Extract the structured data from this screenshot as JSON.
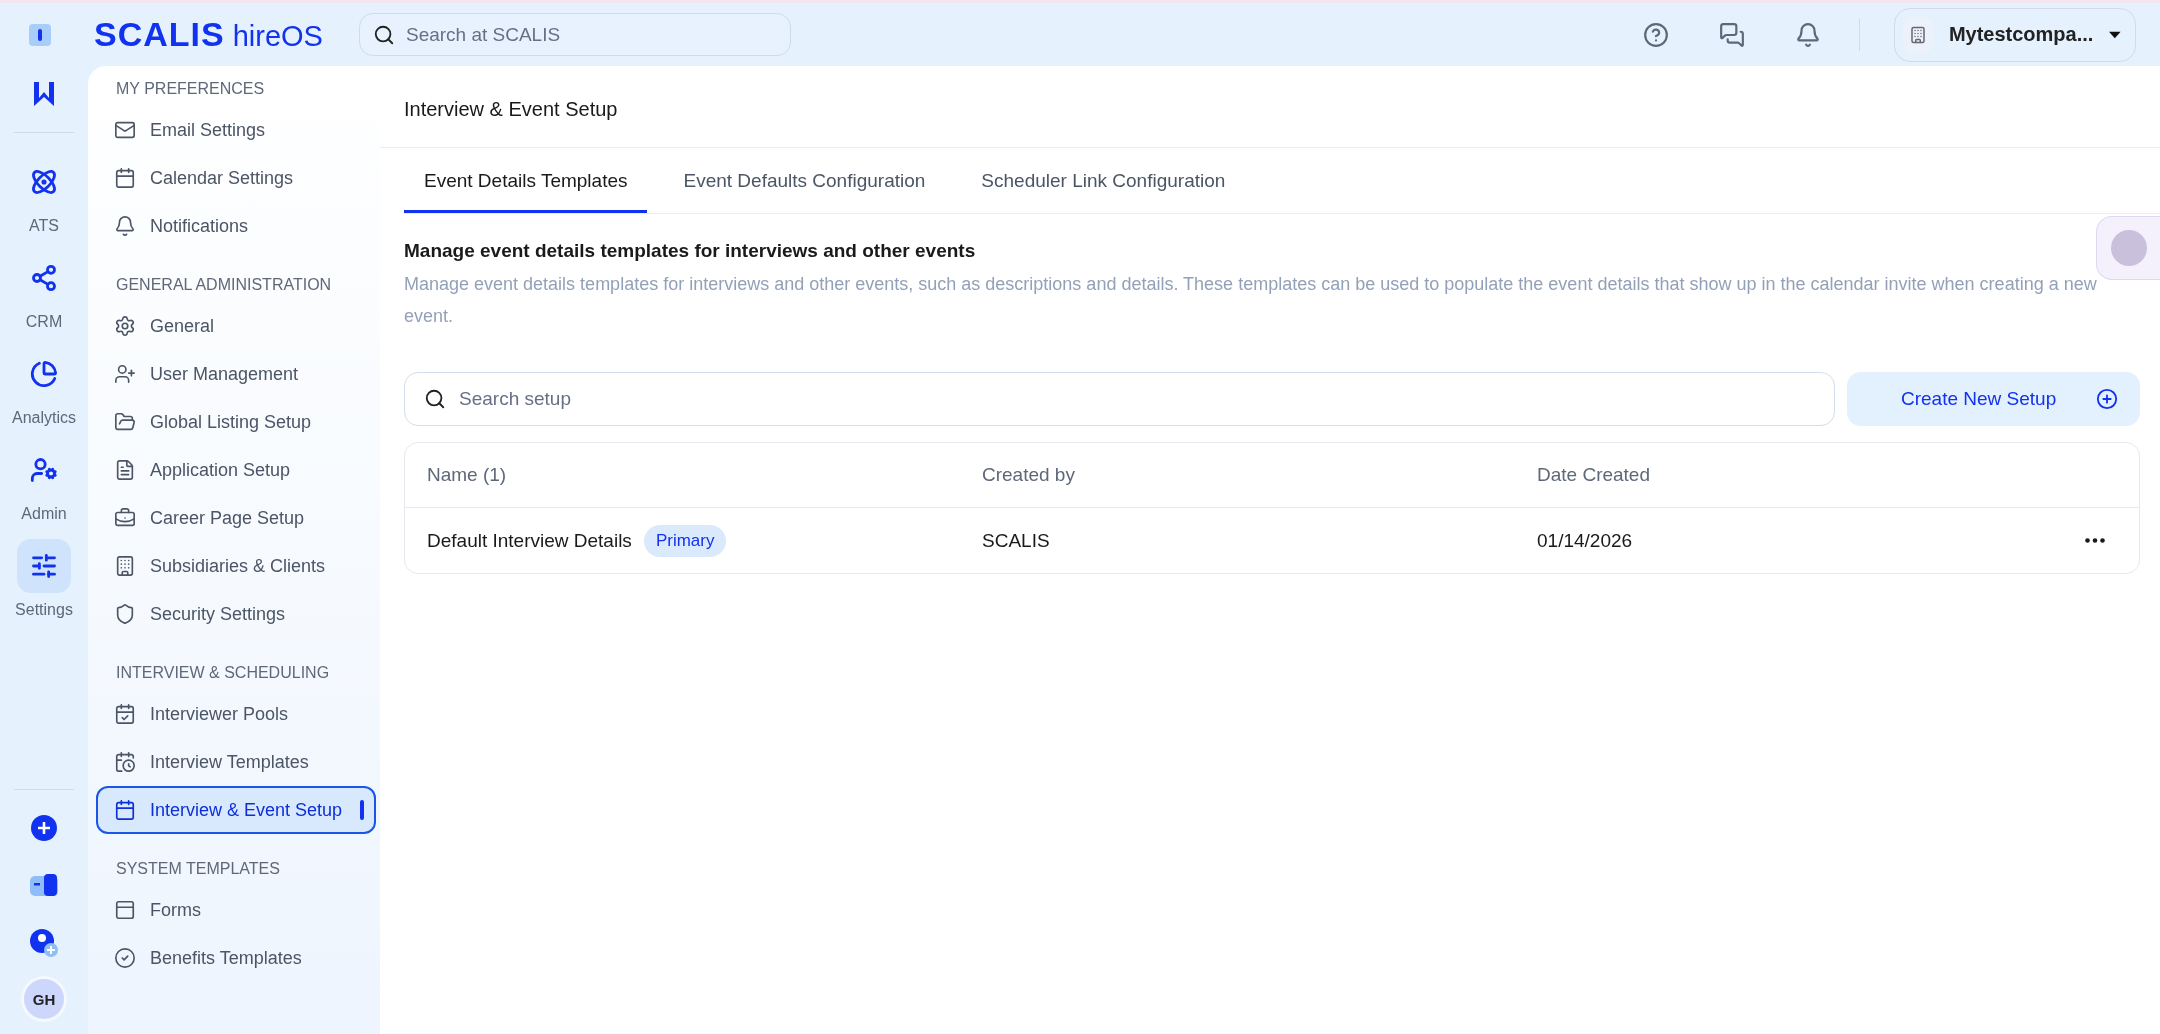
{
  "topbar": {
    "logo_main": "SCALIS",
    "logo_sub": "hireOS",
    "search": {
      "placeholder": "Search at SCALIS"
    },
    "company": "Mytestcompa..."
  },
  "rail": {
    "items": [
      {
        "label": "ATS",
        "selected": false
      },
      {
        "label": "CRM",
        "selected": false
      },
      {
        "label": "Analytics",
        "selected": false
      },
      {
        "label": "Admin",
        "selected": false
      },
      {
        "label": "Settings",
        "selected": true
      }
    ],
    "avatar": "GH"
  },
  "sidebar": {
    "sections": [
      {
        "title": "MY PREFERENCES",
        "items": [
          {
            "label": "Email Settings",
            "selected": false
          },
          {
            "label": "Calendar Settings",
            "selected": false
          },
          {
            "label": "Notifications",
            "selected": false
          }
        ]
      },
      {
        "title": "GENERAL ADMINISTRATION",
        "items": [
          {
            "label": "General",
            "selected": false
          },
          {
            "label": "User Management",
            "selected": false
          },
          {
            "label": "Global Listing Setup",
            "selected": false
          },
          {
            "label": "Application Setup",
            "selected": false
          },
          {
            "label": "Career Page Setup",
            "selected": false
          },
          {
            "label": "Subsidiaries & Clients",
            "selected": false
          },
          {
            "label": "Security Settings",
            "selected": false
          }
        ]
      },
      {
        "title": "INTERVIEW & SCHEDULING",
        "items": [
          {
            "label": "Interviewer Pools",
            "selected": false
          },
          {
            "label": "Interview Templates",
            "selected": false
          },
          {
            "label": "Interview & Event Setup",
            "selected": true
          }
        ]
      },
      {
        "title": "SYSTEM TEMPLATES",
        "items": [
          {
            "label": "Forms",
            "selected": false
          },
          {
            "label": "Benefits Templates",
            "selected": false
          }
        ]
      }
    ]
  },
  "page": {
    "title": "Interview & Event Setup",
    "tabs": [
      {
        "label": "Event Details Templates",
        "selected": true
      },
      {
        "label": "Event Defaults Configuration",
        "selected": false
      },
      {
        "label": "Scheduler Link Configuration",
        "selected": false
      }
    ],
    "heading": "Manage event details templates for interviews and other events",
    "description": "Manage event details templates for interviews and other events, such as descriptions and details. These templates can be used to populate the event details that show up in the calendar invite when creating a new event.",
    "search": {
      "placeholder": "Search setup"
    },
    "create_button": "Create New Setup",
    "table": {
      "columns": [
        "Name (1)",
        "Created by",
        "Date Created"
      ],
      "rows": [
        {
          "name": "Default Interview Details",
          "badge": "Primary",
          "created_by": "SCALIS",
          "date": "01/14/2026"
        }
      ]
    }
  }
}
